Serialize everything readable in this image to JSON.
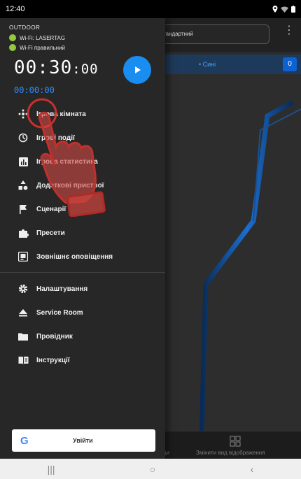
{
  "status_bar": {
    "time": "12:40"
  },
  "background": {
    "preset_value": "тандартний",
    "team_label": "• Сині",
    "team_count": "0",
    "nav_left_label": "анди",
    "nav_right_label": "Змінити вид відображення"
  },
  "drawer": {
    "mode_label": "OUTDOOR",
    "wifi_label": "Wi-Fi: LASERTAG",
    "wifi_status": "Wi-Fi правильний",
    "timer_main": "00:30",
    "timer_main_small": ":00",
    "timer_sub": "00:00:00",
    "menu_primary": [
      {
        "label": "Ігрова кімната",
        "icon": "game-room-icon"
      },
      {
        "label": "Ігрові події",
        "icon": "timer-icon"
      },
      {
        "label": "Ігрова статистика",
        "icon": "stats-icon"
      },
      {
        "label": "Додаткові пристрої",
        "icon": "devices-icon"
      },
      {
        "label": "Сценарії",
        "icon": "flag-icon"
      },
      {
        "label": "Пресети",
        "icon": "puzzle-icon"
      },
      {
        "label": "Зовнішнє оповіщення",
        "icon": "notification-icon"
      }
    ],
    "menu_secondary": [
      {
        "label": "Налаштування",
        "icon": "gear-icon"
      },
      {
        "label": "Service Room",
        "icon": "eject-icon"
      },
      {
        "label": "Провідник",
        "icon": "folder-icon"
      },
      {
        "label": "Інструкції",
        "icon": "book-icon"
      }
    ],
    "google_login_label": "Увійти"
  },
  "colors": {
    "accent": "#1a8ef0",
    "wifi_ok": "#94c940",
    "drawer_bg": "#272727"
  }
}
